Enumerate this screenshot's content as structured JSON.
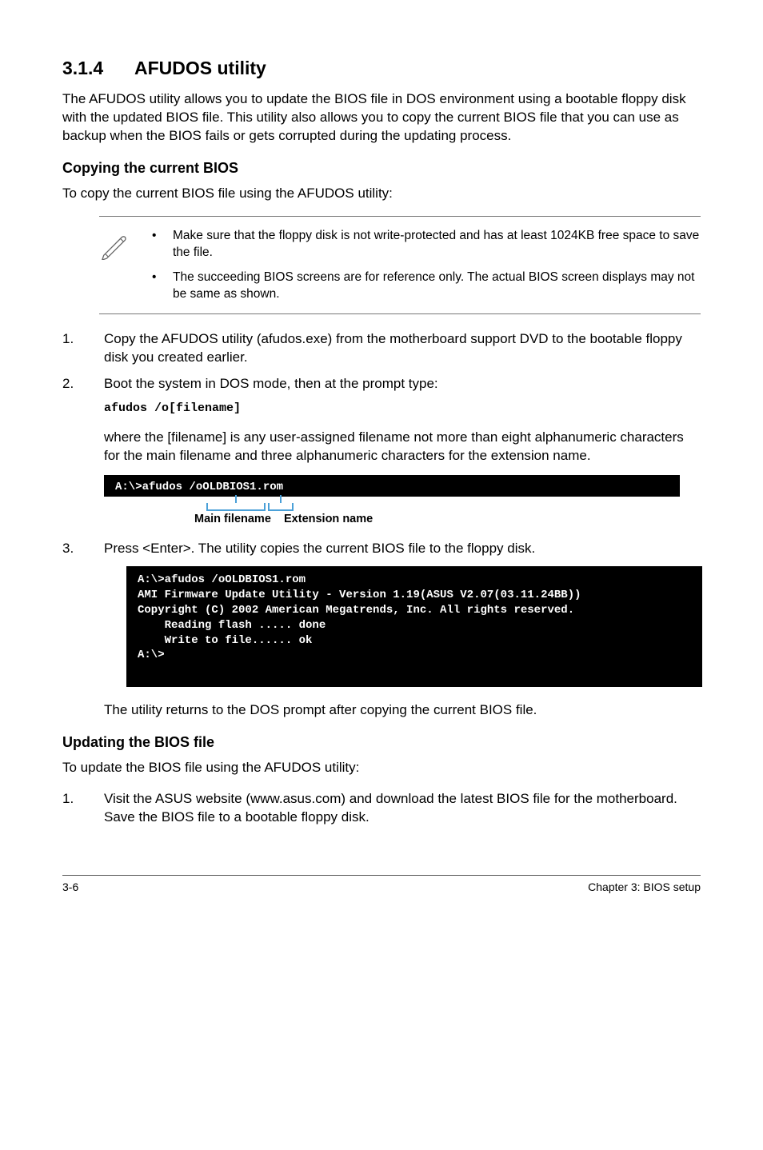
{
  "section": {
    "number": "3.1.4",
    "title": "AFUDOS utility"
  },
  "intro": "The AFUDOS utility allows you to update the BIOS file in DOS environment using a bootable floppy disk with the updated BIOS file. This utility also allows you to copy the current BIOS file that you can use as backup when the BIOS fails or gets corrupted during the updating process.",
  "copying": {
    "heading": "Copying the current BIOS",
    "lead": "To copy the current BIOS file using the AFUDOS utility:"
  },
  "notes": [
    "Make sure that the floppy disk is not write-protected and has at least 1024KB free space to save the file.",
    "The succeeding BIOS screens are for reference only. The actual BIOS screen displays may not be same as shown."
  ],
  "steps_a": [
    {
      "n": "1.",
      "t": "Copy the AFUDOS utility (afudos.exe) from the motherboard support DVD to the bootable floppy disk you created earlier."
    },
    {
      "n": "2.",
      "t": "Boot the system in DOS mode, then at the prompt type:"
    }
  ],
  "cmd": "afudos /o[filename]",
  "where": "where the [filename] is any user-assigned filename not more than eight alphanumeric characters  for the main filename and three alphanumeric characters for the extension name.",
  "term1": "A:\\>afudos /oOLDBIOS1.rom",
  "label_main": "Main filename",
  "label_ext": "Extension name",
  "step3": {
    "n": "3.",
    "t": "Press <Enter>. The utility copies the current BIOS file to the floppy disk."
  },
  "term2": "A:\\>afudos /oOLDBIOS1.rom\nAMI Firmware Update Utility - Version 1.19(ASUS V2.07(03.11.24BB))\nCopyright (C) 2002 American Megatrends, Inc. All rights reserved.\n    Reading flash ..... done\n    Write to file...... ok\nA:\\>",
  "after_term2": "The utility returns to the DOS prompt after copying the current BIOS file.",
  "updating": {
    "heading": "Updating the BIOS file",
    "lead": "To update the BIOS file using the AFUDOS utility:"
  },
  "steps_b": [
    {
      "n": "1.",
      "t": "Visit the ASUS website (www.asus.com) and download the latest BIOS file for the motherboard. Save the BIOS file to a bootable floppy disk."
    }
  ],
  "footer": {
    "left": "3-6",
    "right": "Chapter 3: BIOS setup"
  }
}
